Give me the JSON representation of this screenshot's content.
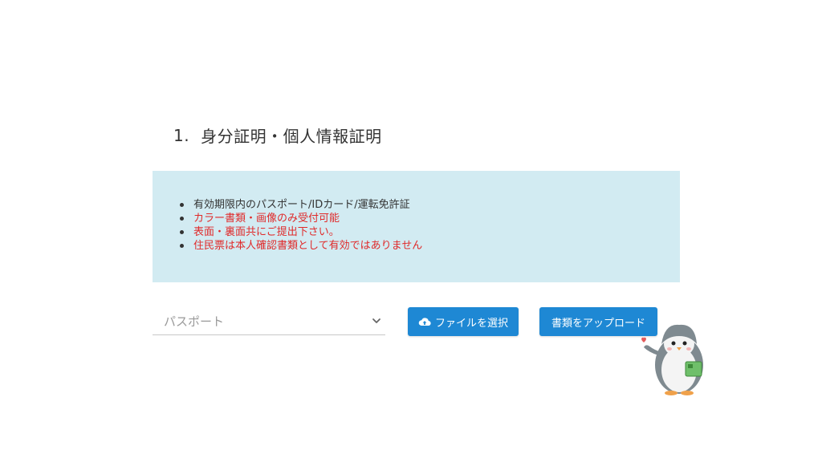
{
  "heading": {
    "number": "1.",
    "title": "身分証明・個人情報証明"
  },
  "notice": {
    "items": [
      {
        "text": "有効期限内のパスポート/IDカード/運転免許証",
        "color": "#333333"
      },
      {
        "text": "カラー書類・画像のみ受付可能",
        "color": "#e02a2a"
      },
      {
        "text": "表面・裏面共にご提出下さい。",
        "color": "#e02a2a"
      },
      {
        "text": "住民票は本人確認書類として有効ではありません",
        "color": "#e02a2a"
      }
    ],
    "background": "#d2ebf2"
  },
  "document_select": {
    "selected": "パスポート",
    "icon": "chevron-down-icon"
  },
  "buttons": {
    "choose_file": {
      "label": "ファイルを選択",
      "icon": "cloud-upload-icon"
    },
    "upload": {
      "label": "書類をアップロード"
    },
    "color": "#1e88d4"
  },
  "mascot": {
    "icon": "penguin-mascot"
  }
}
